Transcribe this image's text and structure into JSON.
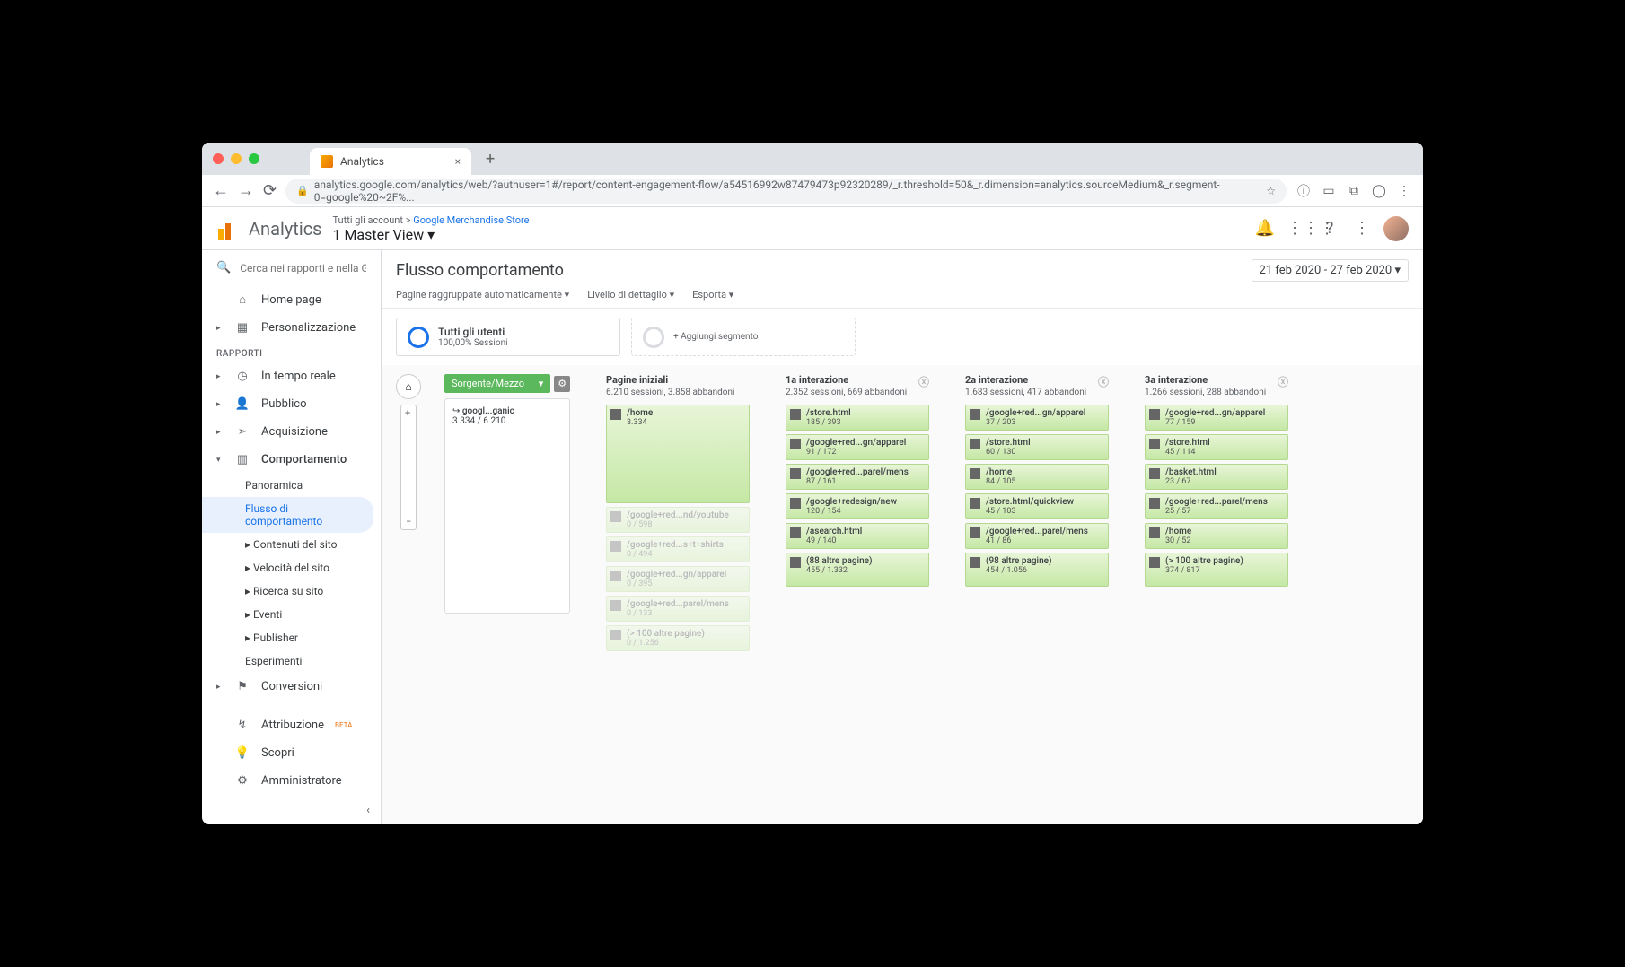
{
  "browser": {
    "tab_title": "Analytics",
    "url_display": "analytics.google.com/analytics/web/?authuser=1#/report/content-engagement-flow/a54516992w87479473p92320289/_r.threshold=50&_r.dimension=analytics.sourceMedium&_r.segment-0=google%20~2F%..."
  },
  "header": {
    "app_name": "Analytics",
    "breadcrumb_all": "Tutti gli account",
    "breadcrumb_store": "Google Merchandise Store",
    "view_name": "1 Master View"
  },
  "sidebar": {
    "search_placeholder": "Cerca nei rapporti e nella G",
    "home": "Home page",
    "custom": "Personalizzazione",
    "reports_label": "RAPPORTI",
    "realtime": "In tempo reale",
    "audience": "Pubblico",
    "acquisition": "Acquisizione",
    "behavior": "Comportamento",
    "behavior_sub": {
      "overview": "Panoramica",
      "flow": "Flusso di comportamento",
      "site_content": "Contenuti del sito",
      "site_speed": "Velocità del sito",
      "site_search": "Ricerca su sito",
      "events": "Eventi",
      "publisher": "Publisher",
      "experiments": "Esperimenti"
    },
    "conversions": "Conversioni",
    "attribution": "Attribuzione",
    "attribution_badge": "BETA",
    "discover": "Scopri",
    "admin": "Amministratore"
  },
  "report": {
    "title": "Flusso comportamento",
    "date_range": "21 feb 2020 - 27 feb 2020",
    "opt_grouped": "Pagine raggruppate automaticamente",
    "opt_detail": "Livello di dettaglio",
    "opt_export": "Esporta",
    "seg_all_title": "Tutti gli utenti",
    "seg_all_sub": "100,00% Sessioni",
    "seg_add": "+ Aggiungi segmento"
  },
  "flow": {
    "dimension_label": "Sorgente/Mezzo",
    "source": {
      "name": "googl...ganic",
      "stats": "3.334 / 6.210"
    },
    "columns": [
      {
        "title": "Pagine iniziali",
        "sub": "6.210 sessioni, 3.858 abbandoni",
        "removable": false,
        "nodes": [
          {
            "t": "/home",
            "v": "3.334",
            "big": true
          },
          {
            "t": "/google+red...nd/youtube",
            "v": "0 / 598",
            "faded": true
          },
          {
            "t": "/google+red...s+t+shirts",
            "v": "0 / 494",
            "faded": true
          },
          {
            "t": "/google+red...gn/apparel",
            "v": "0 / 395",
            "faded": true
          },
          {
            "t": "/google+red...parel/mens",
            "v": "0 / 133",
            "faded": true
          },
          {
            "t": "(> 100 altre pagine)",
            "v": "0 / 1.256",
            "faded": true
          }
        ]
      },
      {
        "title": "1a interazione",
        "sub": "2.352 sessioni, 669 abbandoni",
        "removable": true,
        "nodes": [
          {
            "t": "/store.html",
            "v": "185 / 393"
          },
          {
            "t": "/google+red...gn/apparel",
            "v": "91 / 172"
          },
          {
            "t": "/google+red...parel/mens",
            "v": "87 / 161"
          },
          {
            "t": "/google+redesign/new",
            "v": "120 / 154"
          },
          {
            "t": "/asearch.html",
            "v": "49 / 140"
          },
          {
            "t": "(88 altre pagine)",
            "v": "455 / 1.332",
            "other": true
          }
        ]
      },
      {
        "title": "2a interazione",
        "sub": "1.683 sessioni, 417 abbandoni",
        "removable": true,
        "nodes": [
          {
            "t": "/google+red...gn/apparel",
            "v": "37 / 203"
          },
          {
            "t": "/store.html",
            "v": "60 / 130"
          },
          {
            "t": "/home",
            "v": "84 / 105"
          },
          {
            "t": "/store.html/quickview",
            "v": "45 / 103"
          },
          {
            "t": "/google+red...parel/mens",
            "v": "41 / 86"
          },
          {
            "t": "(98 altre pagine)",
            "v": "454 / 1.056",
            "other": true
          }
        ]
      },
      {
        "title": "3a interazione",
        "sub": "1.266 sessioni, 288 abbandoni",
        "removable": true,
        "nodes": [
          {
            "t": "/google+red...gn/apparel",
            "v": "77 / 159"
          },
          {
            "t": "/store.html",
            "v": "45 / 114"
          },
          {
            "t": "/basket.html",
            "v": "23 / 67"
          },
          {
            "t": "/google+red...parel/mens",
            "v": "25 / 57"
          },
          {
            "t": "/home",
            "v": "30 / 52"
          },
          {
            "t": "(> 100 altre pagine)",
            "v": "374 / 817",
            "other": true
          }
        ]
      }
    ]
  }
}
